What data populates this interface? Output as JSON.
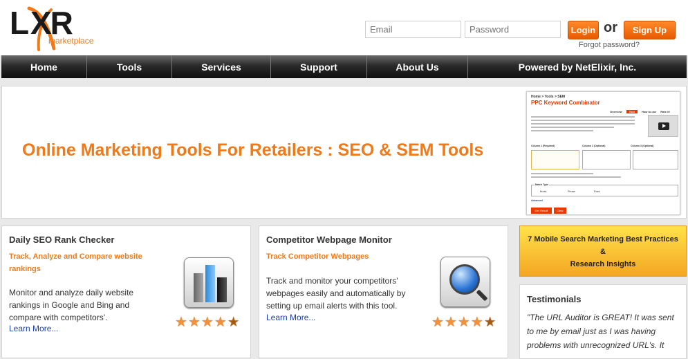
{
  "logo": {
    "letters_l": "L",
    "letters_xr": "XR",
    "sub": "marketplace"
  },
  "login": {
    "email_placeholder": "Email",
    "password_placeholder": "Password",
    "login_label": "Login",
    "or_text": "or",
    "signup_label": "Sign Up",
    "forgot_text": "Forgot password?"
  },
  "nav": {
    "items": [
      "Home",
      "Tools",
      "Services",
      "Support",
      "About Us",
      "Powered by NetElixir, Inc."
    ]
  },
  "hero": {
    "title": "Online Marketing Tools For Retailers : SEO & SEM Tools",
    "preview": {
      "breadcrumb": "Home > Tools > SEM",
      "title": "PPC Keyword Combinator",
      "tabs": [
        "Overview",
        "Tool",
        "How to use",
        "Rate it!"
      ],
      "col1": "Column 1 (Required)",
      "col2": "Column 2 (Optional)",
      "col3": "Column 3 (Optional)",
      "match_type": "Match Type",
      "opt_broad": "Broad",
      "opt_phrase": "Phrase",
      "opt_exact": "Exact",
      "advanced": "Advanced",
      "get_result": "Get Result",
      "clear": "Clear"
    }
  },
  "cards": [
    {
      "title": "Daily SEO Rank Checker",
      "subtitle": "Track, Analyze and Compare website rankings",
      "body": "Monitor and analyze daily website rankings in Google and Bing and compare with competitors'.",
      "link": "Learn More...",
      "icon": "bar-chart-icon",
      "rating": 4.5
    },
    {
      "title": "Competitor Webpage Monitor",
      "subtitle": "Track Competitor Webpages",
      "body": "Track and monitor your competitors' webpages easily and automatically by setting up email alerts with this tool.",
      "link": "Learn More...",
      "icon": "magnifier-globe-icon",
      "rating": 4.5
    }
  ],
  "promo": {
    "line1": "7 Mobile Search Marketing Best Practices",
    "amp": "&",
    "line2": "Research Insights"
  },
  "testimonials": {
    "title": "Testimonials",
    "quote": "\"The URL Auditor is GREAT! It was sent to me by email just as I was having problems with unrecognized URL's. It"
  },
  "colors": {
    "accent": "#f07a1a",
    "nav_dark": "#1a1a1a",
    "link": "#1a3ea8"
  }
}
